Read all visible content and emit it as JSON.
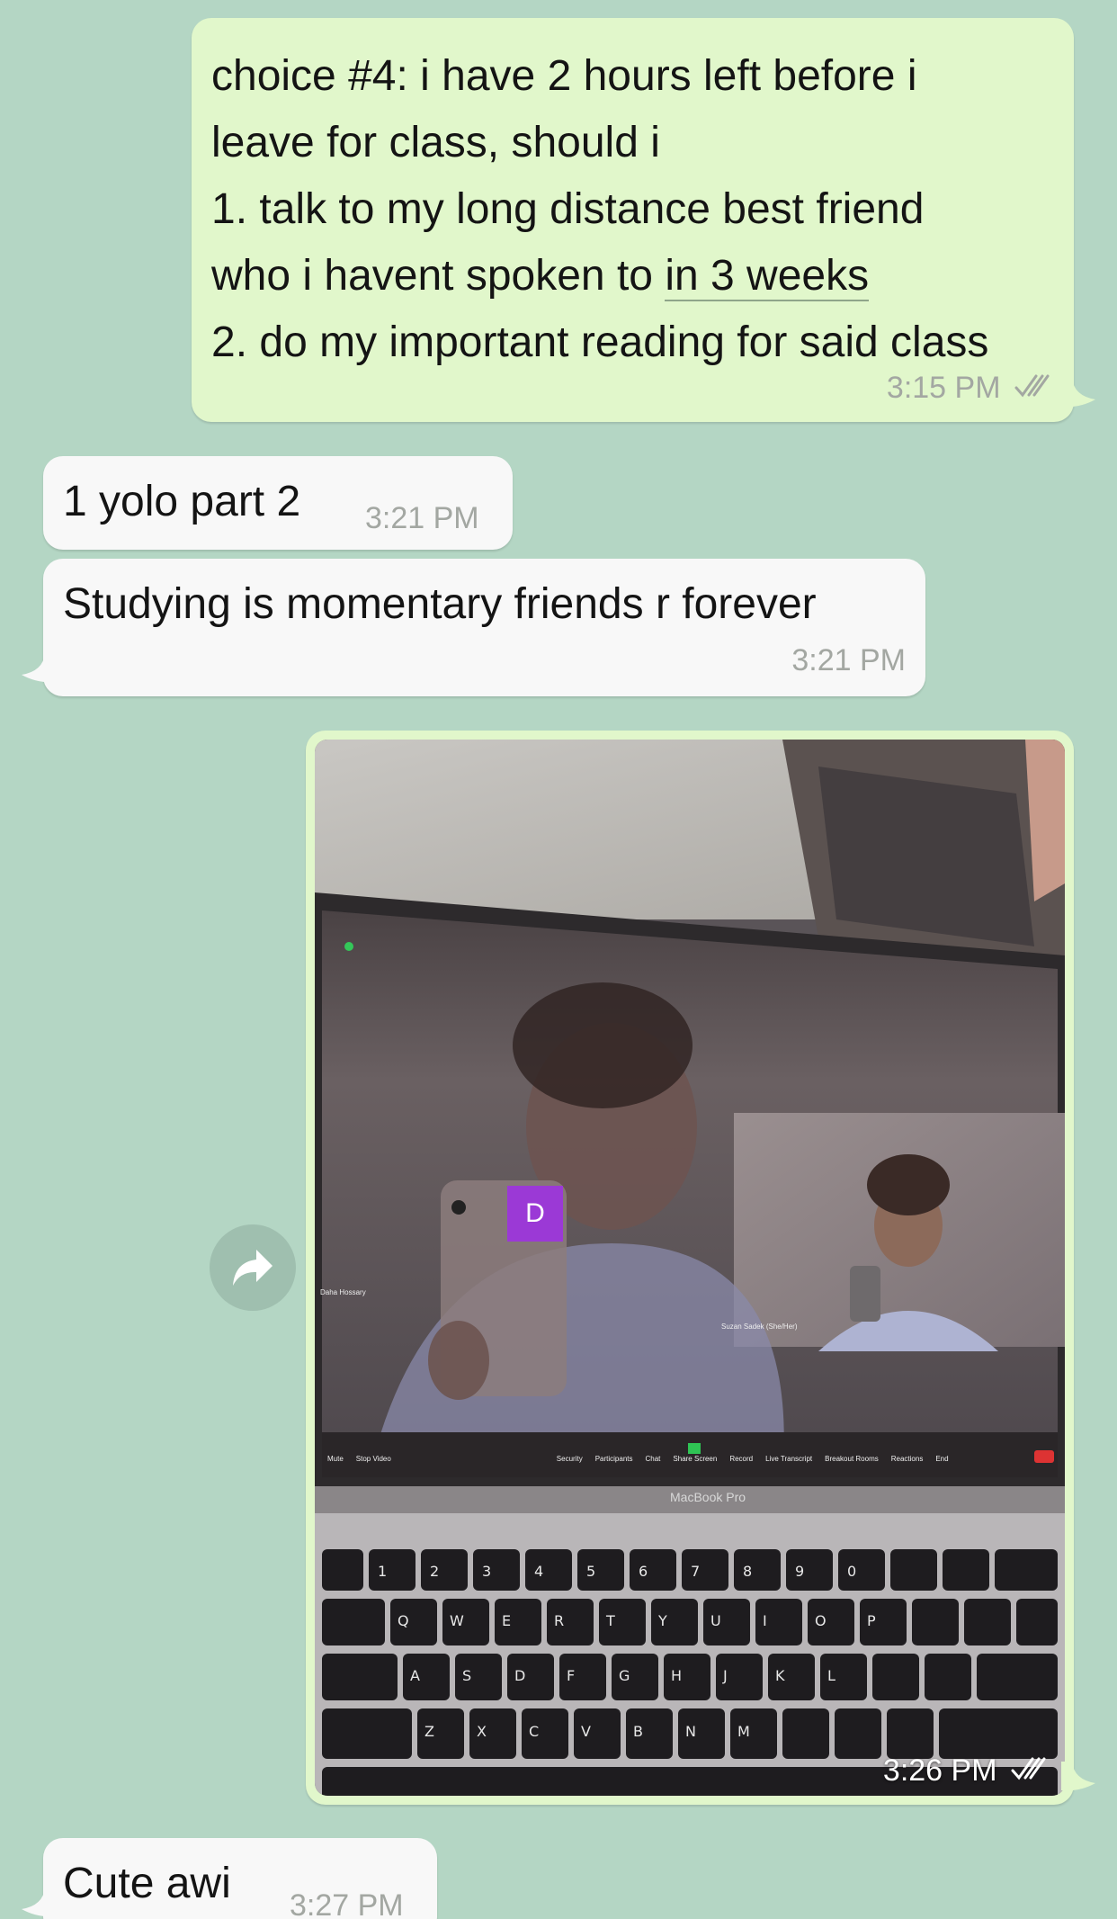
{
  "messages": [
    {
      "id": "m1",
      "direction": "outgoing",
      "lines": [
        "choice #4: i have 2 hours left before i",
        "leave for class, should i",
        "1.  talk to my long distance best friend",
        "who i havent spoken to ",
        "2. do my important reading for said class"
      ],
      "link_text": "in 3 weeks",
      "time": "3:15 PM",
      "status": "read"
    },
    {
      "id": "m2",
      "direction": "incoming",
      "text": "1 yolo part 2",
      "time": "3:21 PM"
    },
    {
      "id": "m3",
      "direction": "incoming",
      "text": "Studying is momentary friends r forever",
      "time": "3:21 PM"
    },
    {
      "id": "m4",
      "direction": "outgoing",
      "type": "photo",
      "time": "3:26 PM",
      "status": "read",
      "photo": {
        "avatar_letter": "D",
        "zoom_left_name": "Daha Hossary",
        "zoom_right_name": "Suzan Sadek (She/Her)",
        "toolbar": [
          "Mute",
          "Stop Video",
          "Security",
          "Participants",
          "Chat",
          "Share Screen",
          "Record",
          "Live Transcript",
          "Breakout Rooms",
          "Reactions",
          "End"
        ],
        "laptop_label": "MacBook Pro"
      }
    },
    {
      "id": "m5",
      "direction": "incoming",
      "text": "Cute awi",
      "time": "3:27 PM"
    }
  ],
  "icons": {
    "forward": "forward-arrow-icon",
    "read_ticks": "double-check-icon"
  },
  "colors": {
    "background": "#b4d6c4",
    "outgoing_bubble": "#e1f7cb",
    "incoming_bubble": "#f8f8f8",
    "timestamp": "#a3a7a2",
    "zoom_avatar": "#9b39d6"
  }
}
